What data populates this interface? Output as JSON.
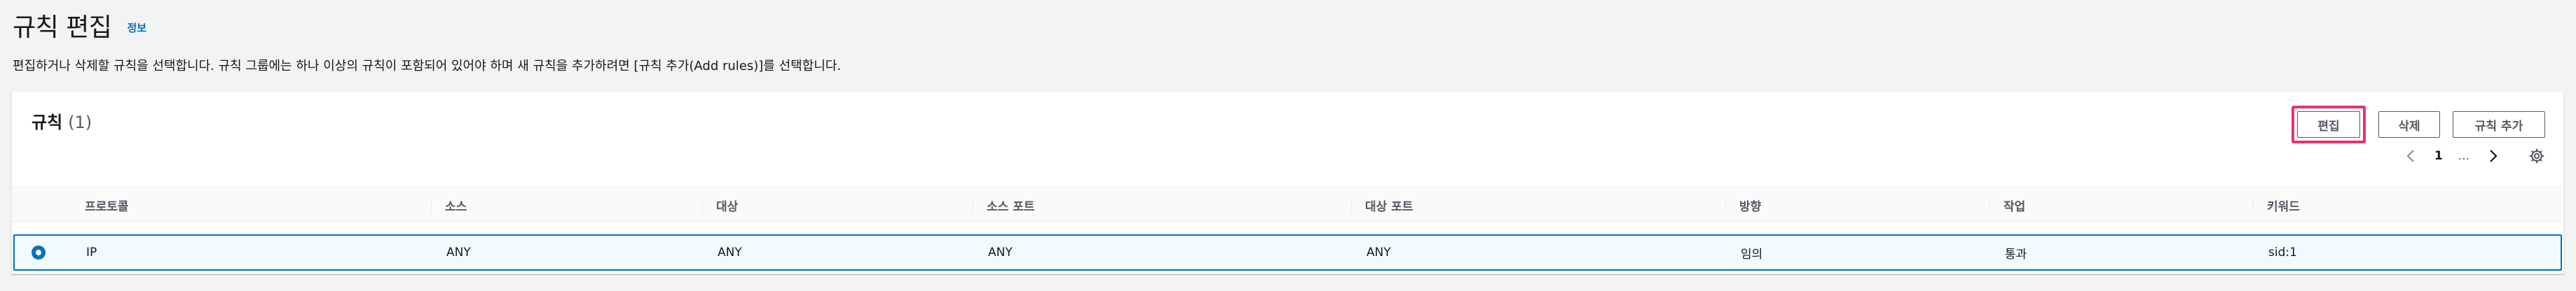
{
  "header": {
    "title": "규칙 편집",
    "info_link": "정보",
    "description": "편집하거나 삭제할 규칙을 선택합니다. 규칙 그룹에는 하나 이상의 규칙이 포함되어 있어야 하며 새 규칙을 추가하려면 [규칙 추가(Add rules)]를 선택합니다."
  },
  "rules_panel": {
    "title": "규칙",
    "count": "(1)",
    "actions": {
      "edit_label": "편집",
      "delete_label": "삭제",
      "add_label": "규칙 추가"
    },
    "pagination": {
      "current_page": "1",
      "ellipsis": "..."
    },
    "columns": [
      "프로토콜",
      "소스",
      "대상",
      "소스 포트",
      "대상 포트",
      "방향",
      "작업",
      "키워드"
    ],
    "rows": [
      {
        "selected": true,
        "protocol": "IP",
        "source": "ANY",
        "destination": "ANY",
        "source_port": "ANY",
        "destination_port": "ANY",
        "direction": "임의",
        "action": "통과",
        "keywords": "sid:1"
      }
    ]
  },
  "colors": {
    "accent": "#0073bb",
    "highlight": "#e8336b",
    "selected_row_bg": "#f1faff"
  },
  "icons": [
    "previous-page-icon",
    "next-page-icon",
    "settings-gear-icon",
    "radio-selected-icon"
  ]
}
